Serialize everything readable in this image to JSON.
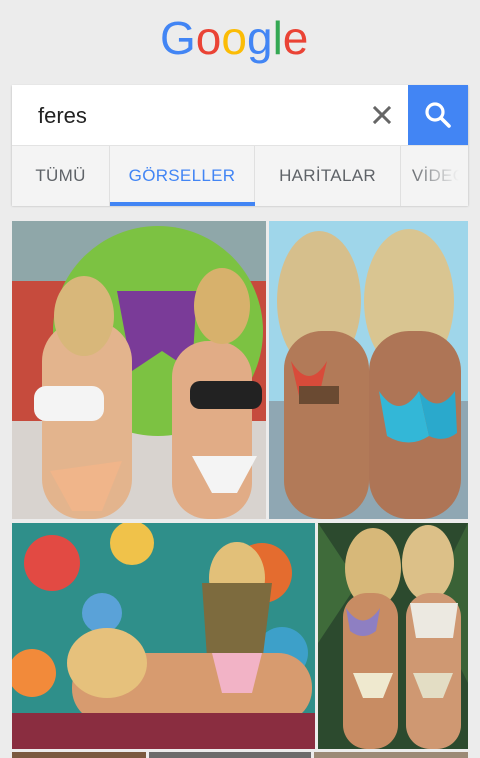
{
  "logo": {
    "letters": [
      "G",
      "o",
      "o",
      "g",
      "l",
      "e"
    ],
    "colors": [
      "#4285f4",
      "#ea4335",
      "#fbbc05",
      "#4285f4",
      "#34a853",
      "#ea4335"
    ]
  },
  "search": {
    "query": "feres"
  },
  "icons": {
    "clear": "close-icon",
    "search": "search-icon"
  },
  "tabs": [
    {
      "label": "TÜMÜ",
      "active": false
    },
    {
      "label": "GÖRSELLER",
      "active": true
    },
    {
      "label": "HARİTALAR",
      "active": false
    },
    {
      "label": "VİDEOLAR",
      "active": false
    }
  ],
  "colors": {
    "accent": "#4285f4",
    "background": "#ececec",
    "tab_bar": "#f4f4f4"
  },
  "results": {
    "images": [
      {
        "name": "image-result-1"
      },
      {
        "name": "image-result-2"
      },
      {
        "name": "image-result-3"
      },
      {
        "name": "image-result-4"
      }
    ]
  }
}
